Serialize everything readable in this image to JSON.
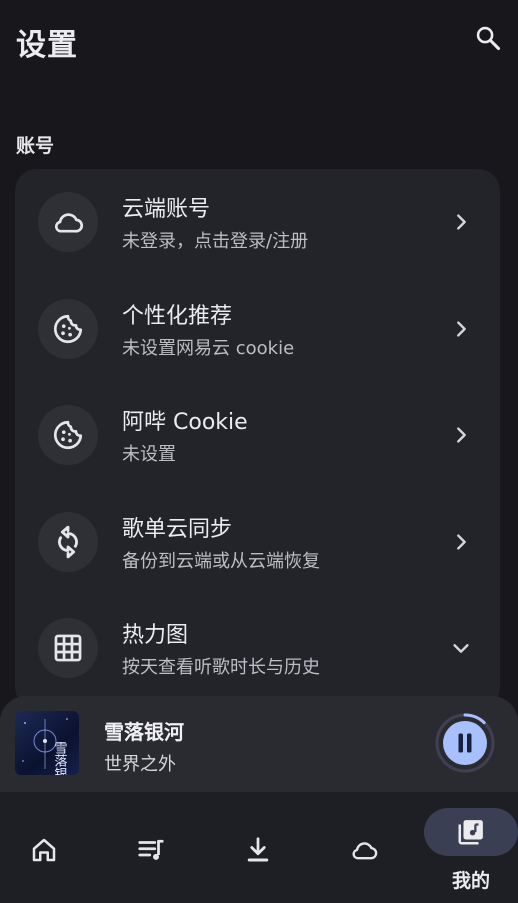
{
  "header": {
    "title": "设置",
    "search_icon": "search-icon"
  },
  "account_section": {
    "title": "账号",
    "items": [
      {
        "icon": "cloud-icon",
        "title": "云端账号",
        "subtitle": "未登录，点击登录/注册",
        "action": "chevron-right-icon"
      },
      {
        "icon": "cookie-icon",
        "title": "个性化推荐",
        "subtitle": "未设置网易云 cookie",
        "action": "chevron-right-icon"
      },
      {
        "icon": "cookie-icon",
        "title": "阿哔 Cookie",
        "subtitle": "未设置",
        "action": "chevron-right-icon"
      },
      {
        "icon": "sync-icon",
        "title": "歌单云同步",
        "subtitle": "备份到云端或从云端恢复",
        "action": "chevron-right-icon"
      },
      {
        "icon": "grid-icon",
        "title": "热力图",
        "subtitle": "按天查看听歌时长与历史",
        "action": "chevron-down-icon"
      }
    ]
  },
  "player": {
    "song_title": "雪落银河",
    "artist": "世界之外",
    "album_art_text": "雪落银河",
    "state": "playing",
    "progress": 0.12,
    "play_pause_icon": "pause-icon"
  },
  "bottom_nav": {
    "items": [
      {
        "icon": "home-icon",
        "label": "",
        "active": false
      },
      {
        "icon": "playlist-icon",
        "label": "",
        "active": false
      },
      {
        "icon": "download-icon",
        "label": "",
        "active": false
      },
      {
        "icon": "cloud-icon",
        "label": "",
        "active": false
      },
      {
        "icon": "music-library-icon",
        "label": "我的",
        "active": true
      }
    ]
  },
  "colors": {
    "background": "#18181c",
    "card": "#232429",
    "accent": "#a9c0ff",
    "nav_active_pill": "#3b3f54"
  }
}
